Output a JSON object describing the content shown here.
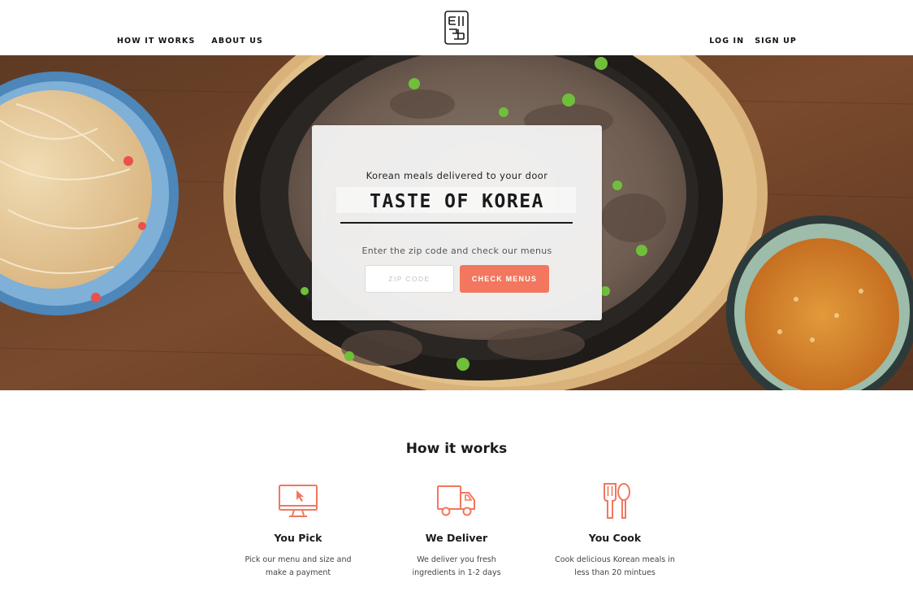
{
  "nav": {
    "left": [
      "HOW IT WORKS",
      "ABOUT US"
    ],
    "right": [
      "LOG IN",
      "SIGN UP"
    ]
  },
  "hero": {
    "tagline": "Korean meals delivered to your door",
    "brand": "TASTE OF KOREA",
    "hint": "Enter the zip code and check our menus",
    "zip_placeholder": "ZIP CODE",
    "zip_value": "",
    "cta": "CHECK MENUS"
  },
  "how": {
    "title": "How it works",
    "steps": [
      {
        "icon": "monitor-icon",
        "title": "You Pick",
        "desc": "Pick our menu and size and make a payment"
      },
      {
        "icon": "truck-icon",
        "title": "We Deliver",
        "desc": "We deliver you fresh ingredients in 1-2 days"
      },
      {
        "icon": "utensils-icon",
        "title": "You Cook",
        "desc": "Cook delicious Korean meals in less than 20 mintues"
      }
    ]
  },
  "colors": {
    "accent": "#f2775e",
    "wood": "#6b4127",
    "pan": "#1e1b19",
    "text": "#1b1b1b"
  }
}
